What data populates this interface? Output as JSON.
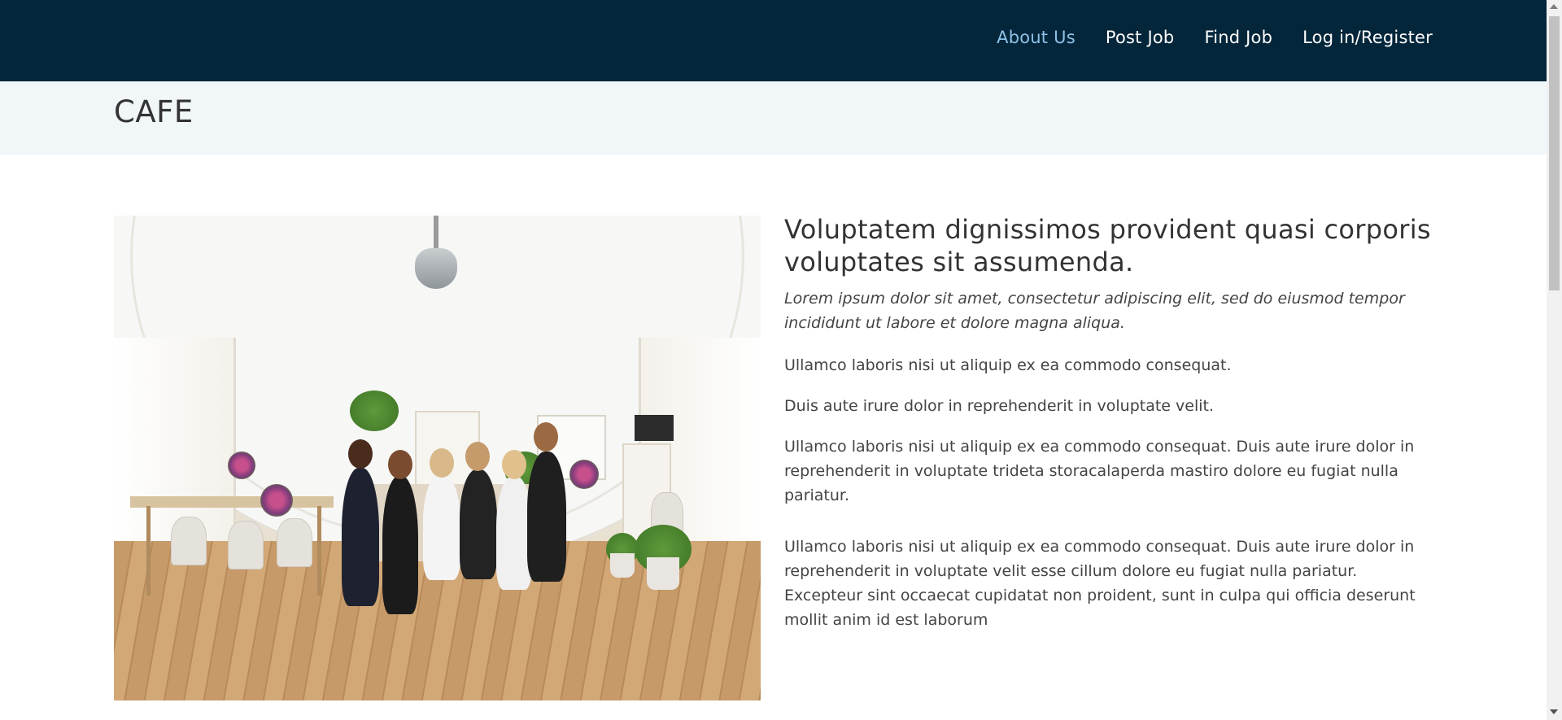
{
  "header": {
    "nav": [
      {
        "label": "About Us",
        "active": true
      },
      {
        "label": "Post Job",
        "active": false
      },
      {
        "label": "Find Job",
        "active": false
      },
      {
        "label": "Log in/Register",
        "active": false
      }
    ]
  },
  "breadcrumbs": {
    "title": "CAFE"
  },
  "about": {
    "image_alt": "Group of women sitting on a sofa in a bright cafe",
    "heading": "Voluptatem dignissimos provident quasi corporis voluptates sit assumenda.",
    "lead": "Lorem ipsum dolor sit amet, consectetur adipiscing elit, sed do eiusmod tempor incididunt ut labore et dolore magna aliqua.",
    "items": [
      " Ullamco laboris nisi ut aliquip ex ea commodo consequat.",
      " Duis aute irure dolor in reprehenderit in voluptate velit.",
      " Ullamco laboris nisi ut aliquip ex ea commodo consequat. Duis aute irure dolor in reprehenderit in voluptate trideta storacalaperda mastiro dolore eu fugiat nulla pariatur."
    ],
    "paragraph": "Ullamco laboris nisi ut aliquip ex ea commodo consequat. Duis aute irure dolor in reprehenderit in voluptate velit esse cillum dolore eu fugiat nulla pariatur. Excepteur sint occaecat cupidatat non proident, sunt in culpa qui officia deserunt mollit anim id est laborum"
  },
  "colors": {
    "header_bg": "#04263b",
    "nav_active": "#8ec1e6",
    "breadcrumb_bg": "#f1f6f9"
  }
}
